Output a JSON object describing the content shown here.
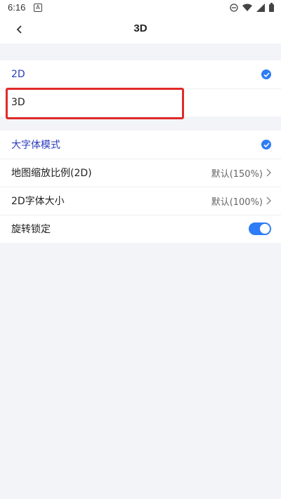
{
  "status": {
    "time": "6:16"
  },
  "nav": {
    "title": "3D"
  },
  "mode_group": {
    "items": [
      {
        "label": "2D",
        "selected": true
      },
      {
        "label": "3D",
        "selected": false
      }
    ]
  },
  "settings": {
    "large_font": {
      "label": "大字体模式",
      "selected": true
    },
    "map_scale": {
      "label": "地图缩放比例(2D)",
      "value": "默认(150%)"
    },
    "font_size_2d": {
      "label": "2D字体大小",
      "value": "默认(100%)"
    },
    "rotation_lock": {
      "label": "旋转锁定",
      "enabled": true
    }
  },
  "colors": {
    "accent": "#2e7cf6",
    "highlight": "#e02a2a",
    "selected_text": "#2b3cbf"
  }
}
